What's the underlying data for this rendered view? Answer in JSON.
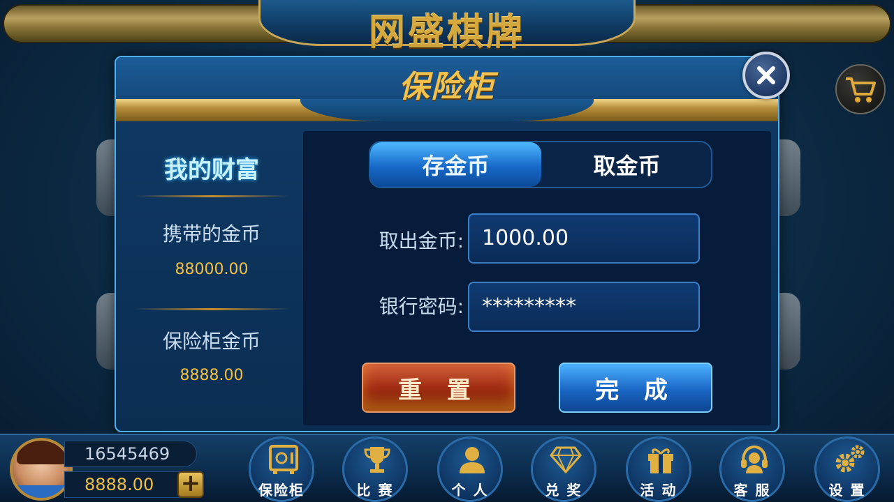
{
  "app": {
    "title": "网盛棋牌"
  },
  "modal": {
    "title": "保险柜",
    "left": {
      "title": "我的财富",
      "carried_label": "携带的金币",
      "carried_value": "88000.00",
      "vault_label": "保险柜金币",
      "vault_value": "8888.00"
    },
    "tabs": [
      {
        "label": "存金币",
        "active": true
      },
      {
        "label": "取金币",
        "active": false
      }
    ],
    "fields": {
      "amount_label": "取出金币:",
      "amount_value": "1000.00",
      "password_label": "银行密码:",
      "password_value": "*********"
    },
    "buttons": {
      "reset": "重 置",
      "done": "完 成"
    }
  },
  "user": {
    "id": "16545469",
    "coins": "8888.00",
    "add_label": "+"
  },
  "nav": [
    {
      "label": "保险柜",
      "icon": "safe-icon"
    },
    {
      "label": "比 赛",
      "icon": "trophy-icon"
    },
    {
      "label": "个 人",
      "icon": "person-icon"
    },
    {
      "label": "兑 奖",
      "icon": "diamond-icon"
    },
    {
      "label": "活 动",
      "icon": "gift-icon"
    },
    {
      "label": "客 服",
      "icon": "headset-icon"
    },
    {
      "label": "设 置",
      "icon": "gear-icon"
    }
  ],
  "colors": {
    "gold": "#f2c042",
    "accent_blue": "#1769c8",
    "reset_red": "#9b2810"
  }
}
